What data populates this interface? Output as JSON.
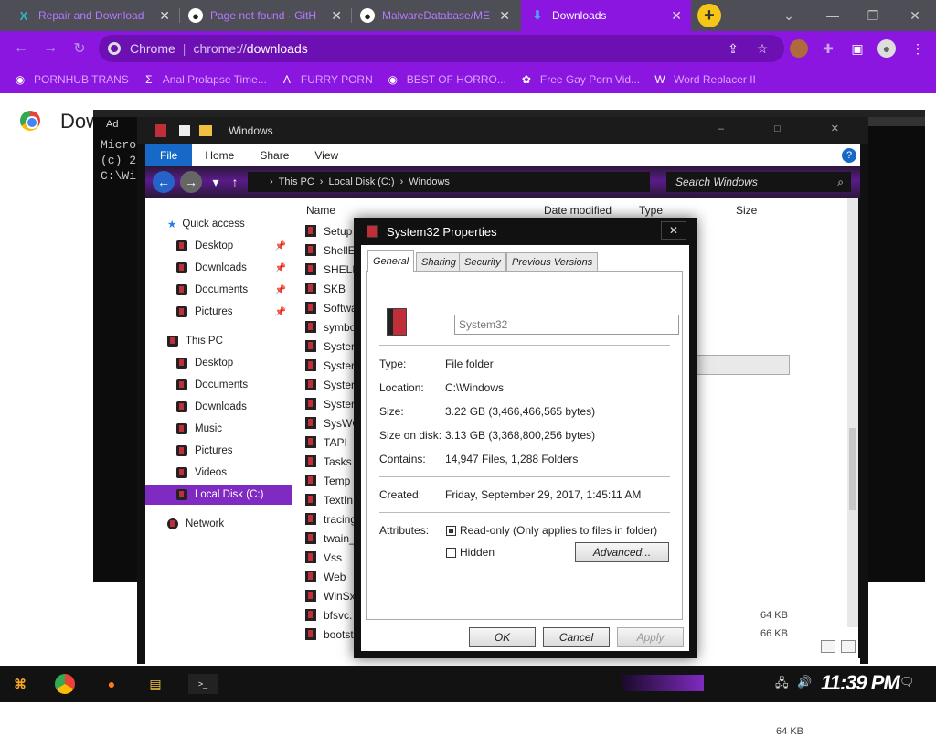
{
  "browser": {
    "tabs": [
      {
        "title": "Repair and Download",
        "icon": "X",
        "active": false
      },
      {
        "title": "Page not found · GitH",
        "icon": "github",
        "active": false
      },
      {
        "title": "MalwareDatabase/ME",
        "icon": "github",
        "active": false
      },
      {
        "title": "Downloads",
        "icon": "download",
        "active": true
      }
    ],
    "address": {
      "chip": "Chrome",
      "scheme": "chrome://",
      "host": "downloads"
    },
    "bookmarks": [
      {
        "label": "PORNHUB TRANS"
      },
      {
        "label": "Anal Prolapse Time..."
      },
      {
        "label": "FURRY PORN"
      },
      {
        "label": "BEST OF HORRO..."
      },
      {
        "label": "Free Gay Porn Vid..."
      },
      {
        "label": "Word Replacer II"
      }
    ],
    "accent": "#8a16e0"
  },
  "page": {
    "title": "Dow"
  },
  "console": {
    "title": "Ad",
    "lines": [
      "Micro",
      "(c) 2",
      "",
      "C:\\Wi"
    ]
  },
  "explorer": {
    "title": "Windows",
    "ribbon": {
      "file": "File",
      "home": "Home",
      "share": "Share",
      "view": "View"
    },
    "breadcrumb": [
      "This PC",
      "Local Disk (C:)",
      "Windows"
    ],
    "search_placeholder": "Search Windows",
    "sidebar": {
      "quick_access": "Quick access",
      "quick_items": [
        "Desktop",
        "Downloads",
        "Documents",
        "Pictures"
      ],
      "this_pc": "This PC",
      "pc_items": [
        "Desktop",
        "Documents",
        "Downloads",
        "Music",
        "Pictures",
        "Videos",
        "Local Disk (C:)"
      ],
      "network": "Network"
    },
    "columns": {
      "name": "Name",
      "date": "Date modified",
      "type": "Type",
      "size": "Size"
    },
    "files": [
      "Setup",
      "ShellE",
      "SHELL",
      "SKB",
      "Softwa",
      "symbo",
      "Syster",
      "Syster",
      "Syster",
      "Syster",
      "SysWO",
      "TAPI",
      "Tasks",
      "Temp",
      "TextIn",
      "tracing",
      "twain_",
      "Vss",
      "Web",
      "WinSx",
      "bfsvc.",
      "bootst"
    ],
    "sizes": [
      "64 KB",
      "66 KB"
    ]
  },
  "dialog": {
    "title": "System32 Properties",
    "tabs": [
      "General",
      "Sharing",
      "Security",
      "Previous Versions"
    ],
    "name": "System32",
    "props": {
      "type_label": "Type:",
      "type_value": "File folder",
      "location_label": "Location:",
      "location_value": "C:\\Windows",
      "size_label": "Size:",
      "size_value": "3.22 GB (3,466,466,565 bytes)",
      "disk_label": "Size on disk:",
      "disk_value": "3.13 GB (3,368,800,256 bytes)",
      "contains_label": "Contains:",
      "contains_value": "14,947 Files, 1,288 Folders",
      "created_label": "Created:",
      "created_value": "Friday, September 29, 2017, 1:45:11 AM",
      "attributes_label": "Attributes:",
      "readonly_label": "Read-only (Only applies to files in folder)",
      "hidden_label": "Hidden",
      "advanced_label": "Advanced..."
    },
    "buttons": {
      "ok": "OK",
      "cancel": "Cancel",
      "apply": "Apply"
    }
  },
  "taskbar": {
    "clock": "11:39 PM"
  }
}
